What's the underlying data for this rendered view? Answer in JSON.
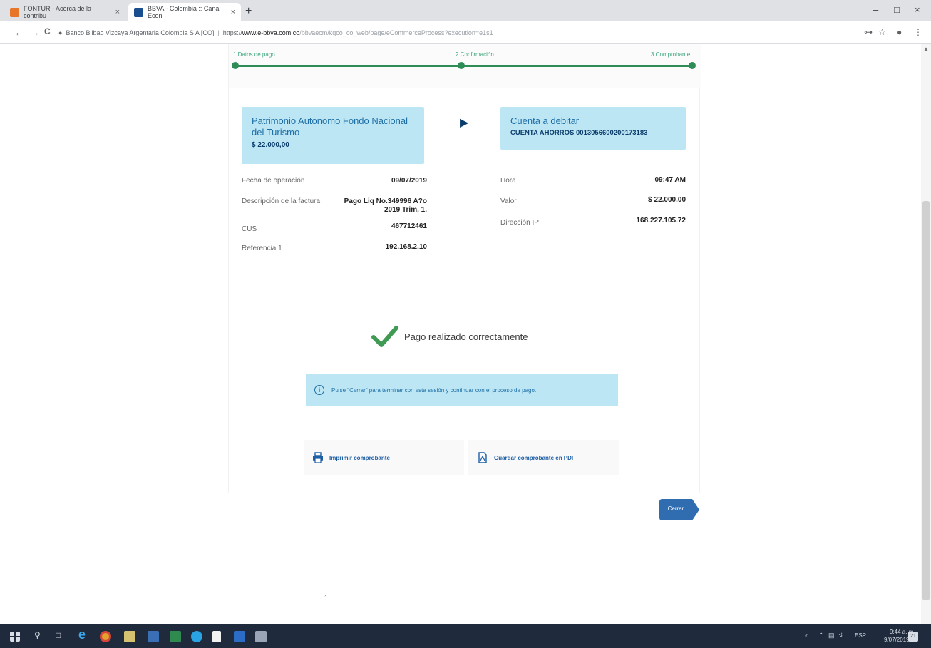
{
  "browser": {
    "tabs": [
      {
        "title": "FONTUR - Acerca de la contribu",
        "active": false
      },
      {
        "title": "BBVA - Colombia :: Canal Econ",
        "active": true
      }
    ],
    "new_tab": "+",
    "close_glyph": "×",
    "window_controls": {
      "minimize": "–",
      "maximize": "□",
      "close": "×"
    },
    "nav": {
      "back": "←",
      "forward": "→",
      "reload": "C"
    },
    "security_label": "Banco Bilbao Vizcaya Argentaria Colombia S A [CO]",
    "url_scheme": "https://",
    "url_host": "www.e-bbva.com.co",
    "url_path": "/bbvaecm/kqco_co_web/page/eCommerceProcess?execution=e1s1",
    "address_icons": [
      "key-icon",
      "star-icon",
      "account-icon",
      "menu-icon"
    ]
  },
  "stepper": {
    "steps": [
      {
        "label": "1.Datos de pago"
      },
      {
        "label": "2.Confirmación"
      },
      {
        "label": "3.Comprobante"
      }
    ]
  },
  "origin": {
    "name": "Patrimonio Autonomo Fondo Nacional del Turismo",
    "amount": "$ 22.000,00"
  },
  "destination": {
    "label": "Cuenta a debitar",
    "account": "CUENTA AHORROS 0013056600200173183"
  },
  "details_left": [
    {
      "label": "Fecha de operación",
      "value": "09/07/2019"
    },
    {
      "label": "Descripción de la factura",
      "value": "Pago Liq No.349996 A?o 2019 Trim. 1."
    },
    {
      "label": "CUS",
      "value": "467712461"
    },
    {
      "label": "Referencia 1",
      "value": "192.168.2.10"
    }
  ],
  "details_right": [
    {
      "label": "Hora",
      "value": "09:47 AM"
    },
    {
      "label": "Valor",
      "value": "$ 22.000.00"
    },
    {
      "label": "Dirección IP",
      "value": "168.227.105.72"
    }
  ],
  "success_message": "Pago realizado correctamente",
  "notice": {
    "icon": "i",
    "text": "Pulse \"Cerrar\" para terminar con esta sesión y continuar con el proceso de pago."
  },
  "actions": {
    "print_label": "Imprimir comprobante",
    "pdf_label": "Guardar comprobante en PDF",
    "close_label": "Cerrar"
  },
  "colors": {
    "accent_green": "#2e8c57",
    "info_bg": "#bde6f5",
    "brand_blue": "#1d6fa5",
    "button_blue": "#2f6db0",
    "taskbar": "#1f2a3c"
  },
  "taskbar": {
    "icons": [
      "windows-start-icon",
      "search-icon",
      "task-view-icon",
      "edge-icon",
      "chrome-icon",
      "file-explorer-icon",
      "store-icon",
      "excel-icon",
      "skype-icon",
      "document-icon",
      "outlook-icon",
      "app-icon"
    ],
    "language": "ESP",
    "time": "9:44 a. m.",
    "date": "9/07/2019",
    "notifications": "21"
  }
}
